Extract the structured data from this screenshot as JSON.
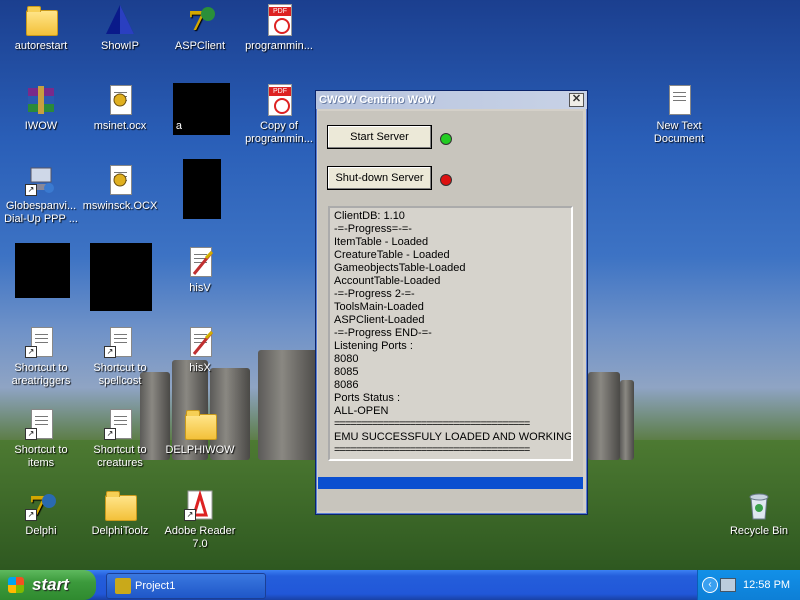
{
  "desktop": {
    "icons": [
      {
        "label": "autorestart"
      },
      {
        "label": "ShowIP"
      },
      {
        "label": "ASPClient"
      },
      {
        "label": "programmin..."
      },
      {
        "label": "IWOW"
      },
      {
        "label": "msinet.ocx"
      },
      {
        "label": "a"
      },
      {
        "label": "Copy of programmin..."
      },
      {
        "label": "Globespanvi... Dial-Up PPP ..."
      },
      {
        "label": "mswinsck.OCX"
      },
      {
        "label": "hisV"
      },
      {
        "label": "Shortcut to areatriggers"
      },
      {
        "label": "Shortcut to spellcost"
      },
      {
        "label": "hisX"
      },
      {
        "label": "Shortcut to items"
      },
      {
        "label": "Shortcut to creatures"
      },
      {
        "label": "DELPHIWOW"
      },
      {
        "label": "Delphi"
      },
      {
        "label": "DelphiToolz"
      },
      {
        "label": "Adobe Reader 7.0"
      },
      {
        "label": "New Text Document"
      },
      {
        "label": "Recycle Bin"
      }
    ]
  },
  "window": {
    "title": "CWOW Centrino WoW",
    "close_glyph": "✕",
    "start_button": "Start Server",
    "shutdown_button": "Shut-down Server",
    "start_status_color": "#22cc22",
    "shutdown_status_color": "#dd1111",
    "log": [
      "ClientDB: 1.10",
      "-=-Progress=-=-",
      "ItemTable - Loaded",
      "CreatureTable - Loaded",
      "GameobjectsTable-Loaded",
      "AccountTable-Loaded",
      "-=-Progress 2-=-",
      "ToolsMain-Loaded",
      "ASPClient-Loaded",
      "-=-Progress END-=-",
      "Listening Ports :",
      "8080",
      "8085",
      "8086",
      "Ports Status :",
      "ALL-OPEN",
      "====================================",
      "EMU SUCCESSFULY LOADED AND WORKING",
      "===================================="
    ]
  },
  "taskbar": {
    "start_label": "start",
    "task_label": "Project1",
    "tray_chevron": "‹",
    "clock": "12:58 PM"
  }
}
